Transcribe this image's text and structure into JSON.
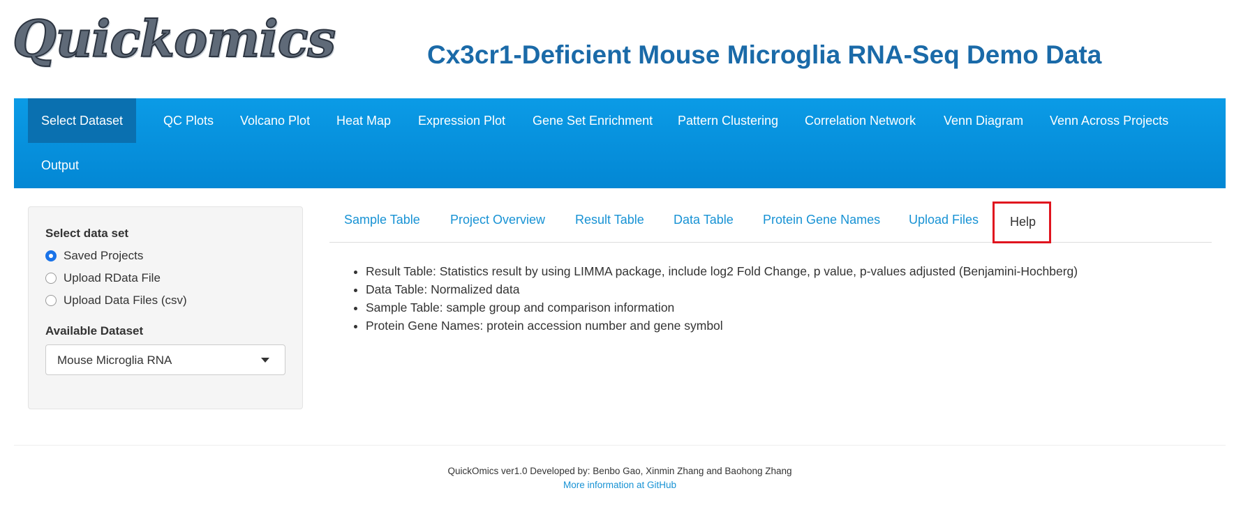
{
  "header": {
    "logo_text": "Quickomics",
    "title": "Cx3cr1-Deficient Mouse Microglia RNA-Seq Demo Data"
  },
  "navbar": {
    "items": [
      {
        "label": "Select Dataset",
        "active": true
      },
      {
        "label": "QC Plots"
      },
      {
        "label": "Volcano Plot"
      },
      {
        "label": "Heat Map"
      },
      {
        "label": "Expression Plot"
      },
      {
        "label": "Gene Set Enrichment"
      },
      {
        "label": "Pattern Clustering"
      },
      {
        "label": "Correlation Network"
      },
      {
        "label": "Venn Diagram"
      },
      {
        "label": "Venn Across Projects"
      },
      {
        "label": "Output"
      }
    ]
  },
  "sidebar": {
    "select_label": "Select data set",
    "options": [
      {
        "label": "Saved Projects",
        "checked": true
      },
      {
        "label": "Upload RData File",
        "checked": false
      },
      {
        "label": "Upload Data Files (csv)",
        "checked": false
      }
    ],
    "available_label": "Available Dataset",
    "dataset_value": "Mouse Microglia RNA"
  },
  "tabs": {
    "items": [
      {
        "label": "Sample Table"
      },
      {
        "label": "Project Overview"
      },
      {
        "label": "Result Table"
      },
      {
        "label": "Data Table"
      },
      {
        "label": "Protein Gene Names"
      },
      {
        "label": "Upload Files"
      },
      {
        "label": "Help",
        "active": true
      }
    ]
  },
  "help_content": {
    "items": [
      "Result Table: Statistics result by using LIMMA package, include log2 Fold Change, p value, p-values adjusted (Benjamini-Hochberg)",
      "Data Table: Normalized data",
      "Sample Table: sample group and comparison information",
      "Protein Gene Names: protein accession number and gene symbol"
    ]
  },
  "footer": {
    "credit": "QuickOmics ver1.0 Developed by: Benbo Gao, Xinmin Zhang and Baohong Zhang",
    "link": "More information at GitHub"
  },
  "colors": {
    "navbar": "#0595de",
    "title": "#1a6aa8",
    "link": "#1792d4",
    "highlight_box": "#e0141e"
  }
}
